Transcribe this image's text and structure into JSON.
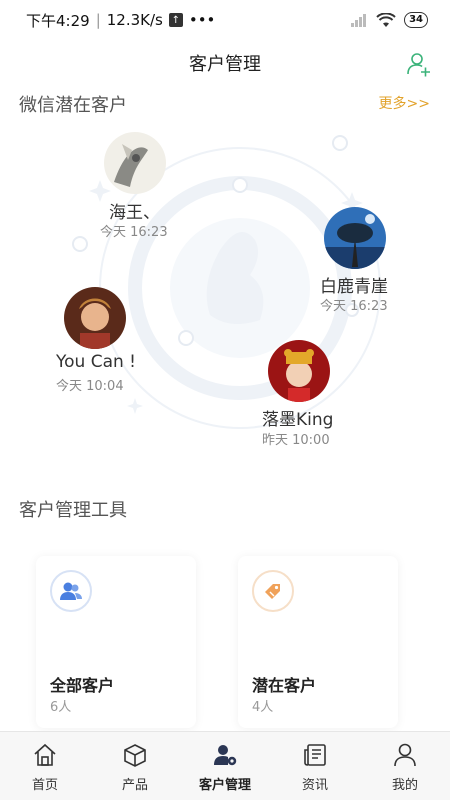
{
  "status_bar": {
    "time": "下午4:29",
    "speed": "12.3K/s",
    "more": "•••",
    "battery": "34"
  },
  "header": {
    "title": "客户管理"
  },
  "potential": {
    "title": "微信潜在客户",
    "more_label": "更多>>",
    "customers": [
      {
        "name": "海王、",
        "time": "今天 16:23"
      },
      {
        "name": "白鹿青崖",
        "time": "今天 16:23"
      },
      {
        "name": "You Can !",
        "time": "今天 10:04"
      },
      {
        "name": "落墨King",
        "time": "昨天 10:00"
      }
    ]
  },
  "tools": {
    "title": "客户管理工具",
    "cards": [
      {
        "name": "全部客户",
        "count": "6人"
      },
      {
        "name": "潜在客户",
        "count": "4人"
      }
    ]
  },
  "bottom_nav": {
    "items": [
      {
        "label": "首页"
      },
      {
        "label": "产品"
      },
      {
        "label": "客户管理"
      },
      {
        "label": "资讯"
      },
      {
        "label": "我的"
      }
    ]
  },
  "colors": {
    "accent_green": "#3bb37a",
    "more_orange": "#e2a32c",
    "primary_blue": "#4a7fe0",
    "tag_orange": "#f0a25a"
  }
}
